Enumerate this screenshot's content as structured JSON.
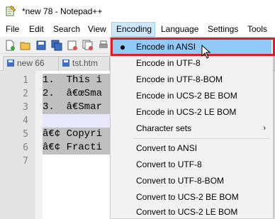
{
  "window": {
    "title": "*new 78 - Notepad++"
  },
  "menubar": {
    "items": [
      {
        "label": "File"
      },
      {
        "label": "Edit"
      },
      {
        "label": "Search"
      },
      {
        "label": "View"
      },
      {
        "label": "Encoding"
      },
      {
        "label": "Language"
      },
      {
        "label": "Settings"
      },
      {
        "label": "Tools"
      }
    ]
  },
  "tabs": [
    {
      "label": "new 66"
    },
    {
      "label": "tst.htm"
    }
  ],
  "editor": {
    "line_numbers": [
      "1",
      "2",
      "3",
      "4",
      "5",
      "6",
      "7"
    ],
    "lines": [
      "1.  This i",
      "2.  â€œSma",
      "3.  â€Smar",
      "",
      "â€¢ Copyri",
      "â€¢ Fracti",
      ""
    ]
  },
  "encoding_menu": {
    "items": [
      {
        "label": "Encode in ANSI",
        "selected": true
      },
      {
        "label": "Encode in UTF-8"
      },
      {
        "label": "Encode in UTF-8-BOM"
      },
      {
        "label": "Encode in UCS-2 BE BOM"
      },
      {
        "label": "Encode in UCS-2 LE BOM"
      },
      {
        "label": "Character sets",
        "submenu": true
      },
      {
        "label": "Convert to ANSI"
      },
      {
        "label": "Convert to UTF-8"
      },
      {
        "label": "Convert to UTF-8-BOM"
      },
      {
        "label": "Convert to UCS-2 BE BOM"
      },
      {
        "label": "Convert to UCS-2 LE BOM"
      }
    ],
    "submenu_arrow": "›"
  },
  "colors": {
    "highlight": "#91c9f7",
    "annotation_box": "#e51b24",
    "menu_active": "#cce8ff"
  }
}
